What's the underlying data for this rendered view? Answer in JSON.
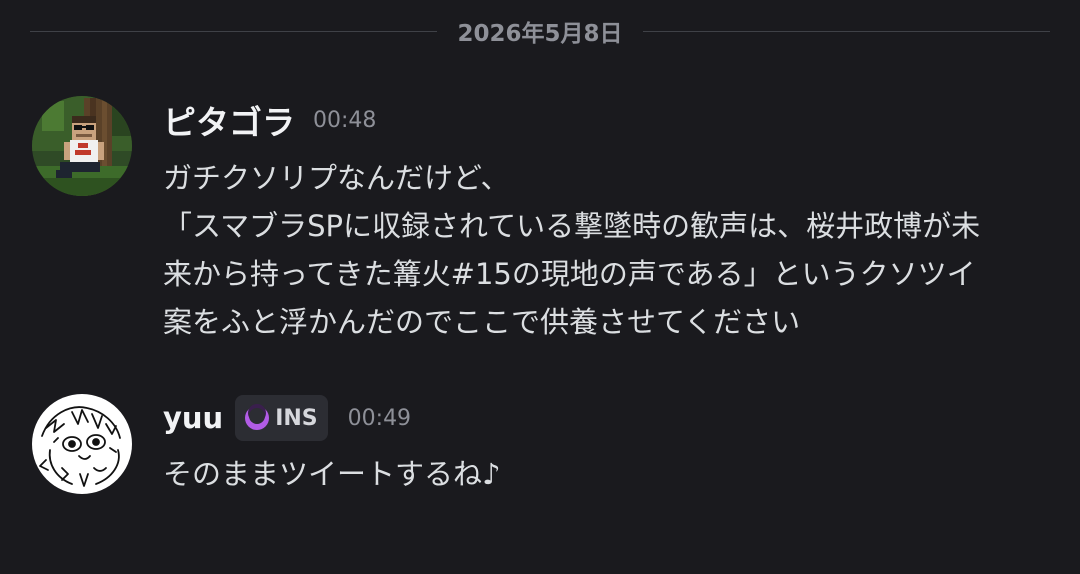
{
  "date_divider": "2026年5月8日",
  "messages": [
    {
      "username": "ピタゴラ",
      "timestamp": "00:48",
      "avatar_icon": "minecraft-character-avatar",
      "lines": [
        "ガチクソリプなんだけど、",
        "「スマブラSPに収録されている撃墜時の歓声は、桜井政博が未",
        "来から持ってきた篝火#15の現地の声である」というクソツイ",
        "案をふと浮かんだのでここで供養させてください"
      ]
    },
    {
      "username": "yuu",
      "tag": {
        "label": "INS",
        "icon": "moon-icon",
        "color": "#b25ce6"
      },
      "timestamp": "00:49",
      "avatar_icon": "sketch-drawing-avatar",
      "lines": [
        "そのままツイートするね♪"
      ]
    }
  ],
  "colors": {
    "background": "#1a1a1e",
    "text": "#dbdee1",
    "muted": "#8e9098",
    "username": "#f2f3f5",
    "tag_bg": "#2c2d33"
  }
}
